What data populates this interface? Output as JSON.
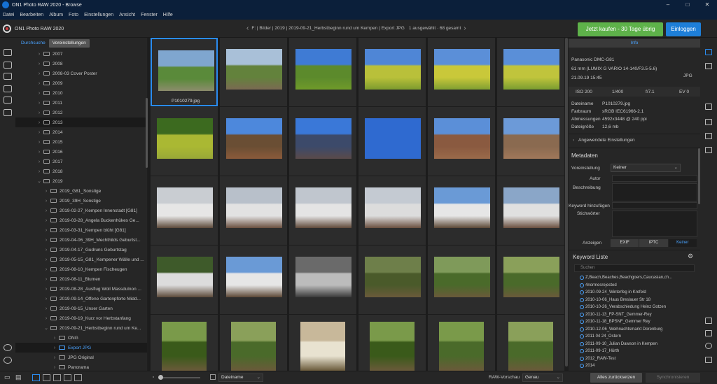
{
  "window": {
    "title": "ON1 Photo RAW 2020 - Browse"
  },
  "menu": [
    "Datei",
    "Bearbeiten",
    "Album",
    "Foto",
    "Einstellungen",
    "Ansicht",
    "Fenster",
    "Hilfe"
  ],
  "header": {
    "app_name": "ON1 Photo RAW 2020",
    "breadcrumb": "F: | Bilder | 2019 | 2019-09-21_Herbstbeginn rund um Kempen | Export JPG",
    "selection_info": "1 ausgewählt · 68 gesamt",
    "buy_label": "Jetzt kaufen - 30 Tage übrig",
    "login_label": "Einloggen"
  },
  "folder_panel": {
    "tab_browse": "Durchsuche",
    "tab_prefs": "Voreinstellungen",
    "folders": [
      {
        "label": "2007",
        "level": 1
      },
      {
        "label": "2008",
        "level": 1
      },
      {
        "label": "2008-03 Cover Poster",
        "level": 1
      },
      {
        "label": "2009",
        "level": 1
      },
      {
        "label": "2010",
        "level": 1
      },
      {
        "label": "2011",
        "level": 1
      },
      {
        "label": "2012",
        "level": 1
      },
      {
        "label": "2013",
        "level": 1
      },
      {
        "label": "2014",
        "level": 1
      },
      {
        "label": "2015",
        "level": 1
      },
      {
        "label": "2016",
        "level": 1
      },
      {
        "label": "2017",
        "level": 1
      },
      {
        "label": "2018",
        "level": 1
      },
      {
        "label": "2019",
        "level": 1
      },
      {
        "label": "2019_G81_Sonstige",
        "level": 2
      },
      {
        "label": "2019_39H_Sonstige",
        "level": 2
      },
      {
        "label": "2019-02-27_Kempen Innenstadt [G81]",
        "level": 2
      },
      {
        "label": "2019-03-28_Angela Buckenhükes Ge...",
        "level": 2
      },
      {
        "label": "2019-03-31_Kempen blüht [G81]",
        "level": 2
      },
      {
        "label": "2019-04-06_39H_Mechthilds Geburtst...",
        "level": 2
      },
      {
        "label": "2019-04-17_Gudruns Geburtstag",
        "level": 2
      },
      {
        "label": "2019-05-15_G81_Kempener Wälle und ...",
        "level": 2
      },
      {
        "label": "2019-08-10_Kempen Fischeugen",
        "level": 2
      },
      {
        "label": "2019-08-11_Blumen",
        "level": 2
      },
      {
        "label": "2019-08-28_Ausflug Woll Massdulnon ...",
        "level": 2
      },
      {
        "label": "2019-09-14_Offene Gartenpforte Midd...",
        "level": 2
      },
      {
        "label": "2019-09-15_Unser Garten",
        "level": 2
      },
      {
        "label": "2019-09-19_Kurz vor Herbstanfang",
        "level": 2
      },
      {
        "label": "2019-09-21_Herbstbeginn rund um Ke...",
        "level": 2
      },
      {
        "label": "ONG",
        "level": 3
      },
      {
        "label": "Export JPG",
        "level": 3
      },
      {
        "label": "JPG Original",
        "level": 3
      },
      {
        "label": "Panorama",
        "level": 3
      }
    ]
  },
  "grid": {
    "selected_label": "P1010279.jpg"
  },
  "info": {
    "tab": "Info",
    "camera": "Panasonic DMC-G81",
    "lens": "61 mm (LUMIX G VARIO 14-140/F3.5-5.6)",
    "datetime": "21.09.19 15:45",
    "format": "JPG",
    "iso": "ISO 200",
    "shutter": "1/400",
    "aperture": "f/7.1",
    "ev": "EV 0",
    "filename_label": "Dateiname",
    "filename": "P1010279.jpg",
    "colorspace_label": "Farbraum",
    "colorspace": "sRGB IEC61966-2.1",
    "dimensions_label": "Abmessungen",
    "dimensions": "4592x3448 @ 240 ppi",
    "filesize_label": "Dateigröße",
    "filesize": "12,6 mb",
    "applied_settings": "Angewendete Einstellungen"
  },
  "metadata": {
    "heading": "Metadaten",
    "preset_label": "Voreinstellung",
    "preset_value": "Keiner",
    "author_label": "Autor",
    "description_label": "Beschreibung",
    "add_keyword_label": "Keyword hinzufügen",
    "keywords_label": "Stichwörter",
    "show_label": "Anzeigen",
    "show_tabs": [
      "EXIF",
      "IPTC",
      "Keiner"
    ]
  },
  "keywords": {
    "heading": "Keyword Liste",
    "search_placeholder": "Suchen",
    "items": [
      "Z,Beach,Beaches,Beachgoers,Caucasian,ch...",
      "4normesrejected",
      "2010-09-24_Winterfeg in Krefeld",
      "2010-10-06_Haus Breslauer Str 18",
      "2010-10-26_Verabschiedung Heinz Gotzen",
      "2010-11-13_FP-SNT_Gemmer-Rey",
      "2010-11-18_BPSNF_Gemmer Rey",
      "2010-12-06_Weihnachtsmarkt Dorenburg",
      "2011 04 24_Ostern",
      "2011-09-10_Julian Dawson in Kempen",
      "2011-09-17_Hürth",
      "2012_RAW-Test",
      "2014"
    ]
  },
  "bottom": {
    "sort_value": "Dateiname",
    "raw_preview_label": "RAW-Vorschau",
    "raw_preview_value": "Genau",
    "reset_label": "Alles zurücksetzen",
    "sync_label": "Synchronisieren"
  },
  "colors": {
    "accent": "#2a8cf0",
    "buy": "#5eb24a",
    "login": "#1e7fd8"
  }
}
